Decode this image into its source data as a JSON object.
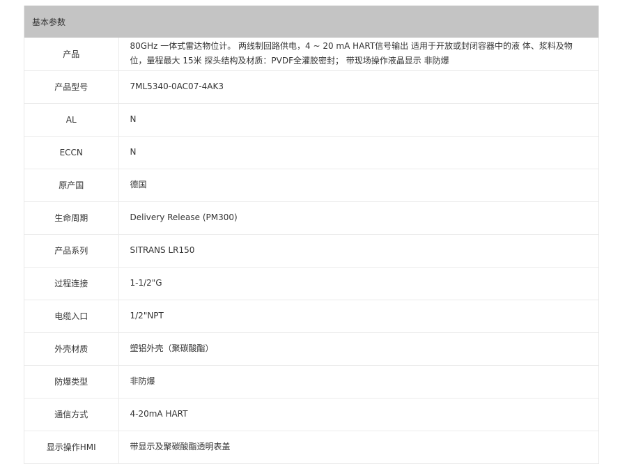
{
  "header": {
    "title": "基本参数"
  },
  "rows": [
    {
      "label": "产品",
      "value": "80GHz 一体式雷达物位计。 两线制回路供电，4 ~ 20 mA HART信号输出 适用于开放或封闭容器中的液 体、浆料及物位，量程最大 15米 探头结构及材质：PVDF全灌胶密封； 带现场操作液晶显示 非防爆"
    },
    {
      "label": "产品型号",
      "value": "7ML5340-0AC07-4AK3"
    },
    {
      "label": "AL",
      "value": "N"
    },
    {
      "label": "ECCN",
      "value": "N"
    },
    {
      "label": "原产国",
      "value": "德国"
    },
    {
      "label": "生命周期",
      "value": "Delivery Release (PM300)"
    },
    {
      "label": "产品系列",
      "value": "SITRANS LR150"
    },
    {
      "label": "过程连接",
      "value": "1-1/2\"G"
    },
    {
      "label": "电缆入口",
      "value": "1/2\"NPT"
    },
    {
      "label": "外壳材质",
      "value": "塑铝外壳（聚碳酸酯）"
    },
    {
      "label": "防爆类型",
      "value": "非防爆"
    },
    {
      "label": "通信方式",
      "value": "4-20mA HART"
    },
    {
      "label": "显示操作HMI",
      "value": "带显示及聚碳酸酯透明表盖"
    }
  ]
}
